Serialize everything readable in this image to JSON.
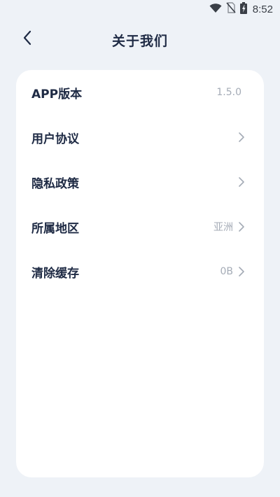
{
  "status_bar": {
    "time": "8:52",
    "icons": [
      "wifi-icon",
      "no-sim-icon",
      "battery-charging-icon"
    ]
  },
  "header": {
    "title": "关于我们",
    "back_icon": "chevron-left-icon"
  },
  "settings": {
    "rows": [
      {
        "label": "APP版本",
        "value": "1.5.0",
        "has_chevron": false
      },
      {
        "label": "用户协议",
        "value": "",
        "has_chevron": true
      },
      {
        "label": "隐私政策",
        "value": "",
        "has_chevron": true
      },
      {
        "label": "所属地区",
        "value": "亚洲",
        "has_chevron": true
      },
      {
        "label": "清除缓存",
        "value": "0B",
        "has_chevron": true
      }
    ]
  },
  "colors": {
    "background": "#eef2f7",
    "card": "#ffffff",
    "primary_text": "#1e2a44",
    "secondary_text": "#a4abb6"
  }
}
